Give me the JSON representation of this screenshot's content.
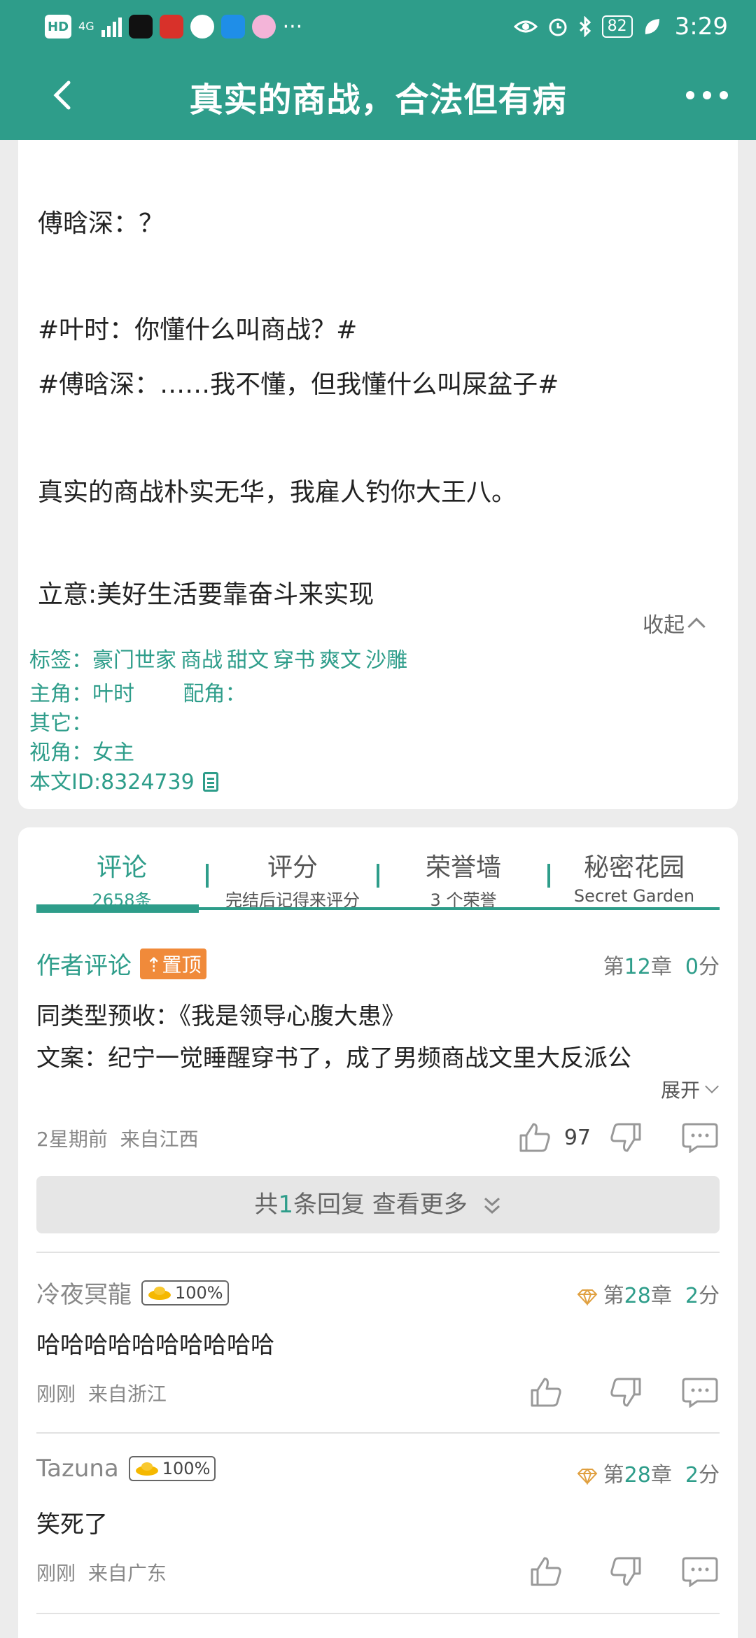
{
  "status_bar": {
    "hd": "HD",
    "network": "4G",
    "battery": "82",
    "time": "3:29",
    "apps": [
      "tiktok-icon",
      "news-icon",
      "message-icon",
      "search-icon",
      "gallery-icon"
    ],
    "overflow": "···"
  },
  "nav": {
    "title": "真实的商战，合法但有病"
  },
  "description": {
    "paragraphs": [
      "傅晗深：？",
      "#叶时：你懂什么叫商战？#",
      "#傅晗深：……我不懂，但我懂什么叫屎盆子#",
      "真实的商战朴实无华，我雇人钓你大王八。",
      "立意:美好生活要靠奋斗来实现"
    ],
    "collapse_label": "收起",
    "tags_label": "标签：",
    "tags": [
      "豪门世家",
      "商战",
      "甜文",
      "穿书",
      "爽文",
      "沙雕"
    ],
    "protagonist_label": "主角：",
    "protagonist": "叶时",
    "supporting_label": "配角：",
    "supporting": "",
    "other_label": "其它：",
    "other": "",
    "perspective_label": "视角：",
    "perspective": "女主",
    "id_label": "本文ID:",
    "id": "8324739"
  },
  "tabs": [
    {
      "title": "评论",
      "sub": "2658条"
    },
    {
      "title": "评分",
      "sub": "完结后记得来评分"
    },
    {
      "title": "荣誉墙",
      "sub": "3 个荣誉"
    },
    {
      "title": "秘密花园",
      "sub": "Secret Garden"
    }
  ],
  "author_comment": {
    "label": "作者评论",
    "pin_label": "置顶",
    "chapter_prefix": "第",
    "chapter": "12",
    "chapter_suffix": "章",
    "score": "0",
    "score_suffix": "分",
    "line1": "同类型预收：《我是领导心腹大患》",
    "line2": "文案：纪宁一觉睡醒穿书了，成了男频商战文里大反派公",
    "expand_label": "展开",
    "time": "2星期前",
    "location": "来自江西",
    "likes": "97"
  },
  "reply_bar": {
    "prefix": "共",
    "count": "1",
    "suffix": "条回复 查看更多"
  },
  "comments": [
    {
      "user": "冷夜冥龍",
      "badge": "100%",
      "chapter": "28",
      "score": "2",
      "text": "哈哈哈哈哈哈哈哈哈哈",
      "time": "刚刚",
      "location": "来自浙江"
    },
    {
      "user": "Tazuna",
      "badge": "100%",
      "chapter": "28",
      "score": "2",
      "text": "笑死了",
      "time": "刚刚",
      "location": "来自广东"
    }
  ],
  "colors": {
    "brand": "#2e9d8a",
    "pin": "#f08a3a"
  }
}
